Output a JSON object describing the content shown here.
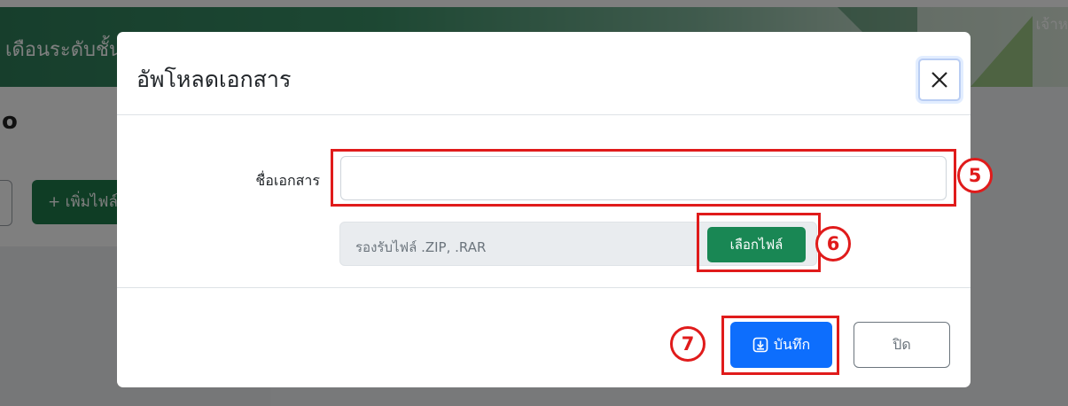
{
  "background": {
    "page_title": "เดือนระดับชั้นสัง",
    "user_label": "เจ้าห",
    "add_button_label": "+ เพิ่มไฟล์"
  },
  "modal": {
    "title": "อัพโหลดเอกสาร",
    "doc_name_label": "ชื่อเอกสาร",
    "doc_name_value": "",
    "file_hint": "รองรับไฟล์ .ZIP, .RAR",
    "choose_file_label": "เลือกไฟล์",
    "save_label": "บันทึก",
    "close_label": "ปิด"
  },
  "annotations": [
    "5",
    "6",
    "7"
  ],
  "colors": {
    "primary": "#0d6efd",
    "success": "#198754",
    "annotation": "#e01b1b",
    "header_green": "#2e7d59"
  }
}
